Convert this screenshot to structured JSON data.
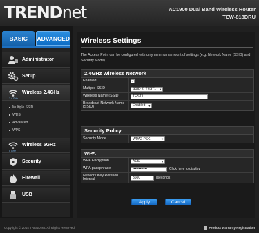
{
  "brand": {
    "logo_main": "TREND",
    "logo_suffix": "net"
  },
  "product": {
    "name": "AC1900 Dual Band Wireless Router",
    "model": "TEW-818DRU"
  },
  "modes": [
    {
      "label": "BASIC"
    },
    {
      "label": "ADVANCED"
    }
  ],
  "nav": {
    "items": [
      {
        "label": "Administrator",
        "icon": "administrator-icon"
      },
      {
        "label": "Setup",
        "icon": "setup-gear-icon"
      },
      {
        "label": "Wireless 2.4GHz",
        "icon": "wireless-icon",
        "freq": "2.4 GHz"
      },
      {
        "label": "Wireless 5GHz",
        "icon": "wireless-icon",
        "freq": "5 GHz"
      },
      {
        "label": "Security",
        "icon": "shield-icon"
      },
      {
        "label": "Firewall",
        "icon": "firewall-icon"
      },
      {
        "label": "USB",
        "icon": "usb-icon"
      }
    ],
    "subitems": [
      "Multiple SSID",
      "WDS",
      "Advanced",
      "WPS"
    ]
  },
  "page": {
    "title": "Wireless Settings",
    "description": "The Access Point can be configured with only minimum amount of settings (e.g. Network Name (SSID) and Security Mode)."
  },
  "wireless24": {
    "heading": "2.4GHz Wireless Network",
    "enabled_label": "Enabled",
    "enabled_checked": "✓",
    "multiple_ssid_label": "Multiple SSID",
    "multiple_ssid_value": "SSID 2: TEST1",
    "wireless_name_label": "Wireless Name (SSID)",
    "wireless_name_value": "TEST1",
    "broadcast_label": "Broadcast Network Name (SSID)",
    "broadcast_value": "Enabled"
  },
  "security_policy": {
    "heading": "Security Policy",
    "mode_label": "Security Mode",
    "mode_value": "WPA2-PSK"
  },
  "wpa": {
    "heading": "WPA",
    "encryption_label": "WPA Encryption",
    "encryption_value": "AES",
    "passphrase_label": "WPA passphrase",
    "passphrase_value": "••••••••••••",
    "passphrase_hint": "Click here to display",
    "rotation_label": "Network Key Rotation Interval",
    "rotation_value": "3600",
    "rotation_unit": "(seconds)"
  },
  "buttons": {
    "apply": "Apply",
    "cancel": "Cancel"
  },
  "footer": {
    "copyright": "Copyright © 2014 TRENDnet. All Rights Reserved.",
    "warranty": "Product Warranty Registration"
  },
  "colors": {
    "accent": "#1d6fbf",
    "background": "#1f1f1f"
  }
}
